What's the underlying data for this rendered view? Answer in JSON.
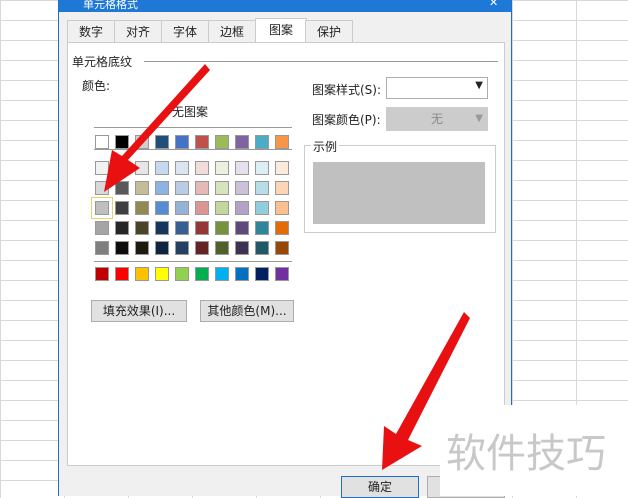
{
  "dialog": {
    "title": "单元格格式",
    "close": "✕"
  },
  "tabs": [
    {
      "label": "数字"
    },
    {
      "label": "对齐"
    },
    {
      "label": "字体"
    },
    {
      "label": "边框"
    },
    {
      "label": "图案",
      "active": true
    },
    {
      "label": "保护"
    }
  ],
  "shading": {
    "group_label": "单元格底纹",
    "color_label": "颜色:",
    "no_pattern": "无图案",
    "theme_colors": [
      [
        "#ffffff",
        "#000000",
        "#d0cece",
        "#1f4e79",
        "#4472c4",
        "#c0504d",
        "#9bbb59",
        "#8064a2",
        "#4bacc6",
        "#f79646"
      ],
      [
        "#f2f2f2",
        "#7f7f7f",
        "#e7e6e6",
        "#c6d9f0",
        "#dbe5f1",
        "#f2dcdb",
        "#ebf1dd",
        "#e5e0ec",
        "#dbeef3",
        "#fdeada"
      ],
      [
        "#d8d8d8",
        "#595959",
        "#c4bd97",
        "#8db3e2",
        "#b8cce4",
        "#e5b9b7",
        "#d7e3bc",
        "#ccc1d9",
        "#b7dde8",
        "#fbd5b5"
      ],
      [
        "#bfbfbf",
        "#3f3f3f",
        "#938953",
        "#548dd4",
        "#95b3d7",
        "#d99694",
        "#c3d69b",
        "#b2a2c7",
        "#92cddc",
        "#fac08f"
      ],
      [
        "#a5a5a5",
        "#262626",
        "#494429",
        "#17365d",
        "#366092",
        "#953734",
        "#76923c",
        "#5f497a",
        "#31859b",
        "#e36c09"
      ],
      [
        "#7f7f7f",
        "#0c0c0c",
        "#1d1b10",
        "#0f243e",
        "#244061",
        "#632423",
        "#4f6128",
        "#3f3151",
        "#205867",
        "#974806"
      ]
    ],
    "standard_colors": [
      "#c00000",
      "#ff0000",
      "#ffc000",
      "#ffff00",
      "#92d050",
      "#00b050",
      "#00b0f0",
      "#0070c0",
      "#002060",
      "#7030a0"
    ],
    "selected": "row 4, col 1",
    "fill_effects": "填充效果(I)...",
    "more_colors": "其他颜色(M)..."
  },
  "pattern": {
    "style_label": "图案样式(S):",
    "style_value": "",
    "color_label": "图案颜色(P):",
    "color_value": "无",
    "sample_label": "示例",
    "sample_color": "#c0c0c0"
  },
  "footer": {
    "ok": "确定"
  },
  "watermark": "软件技巧"
}
